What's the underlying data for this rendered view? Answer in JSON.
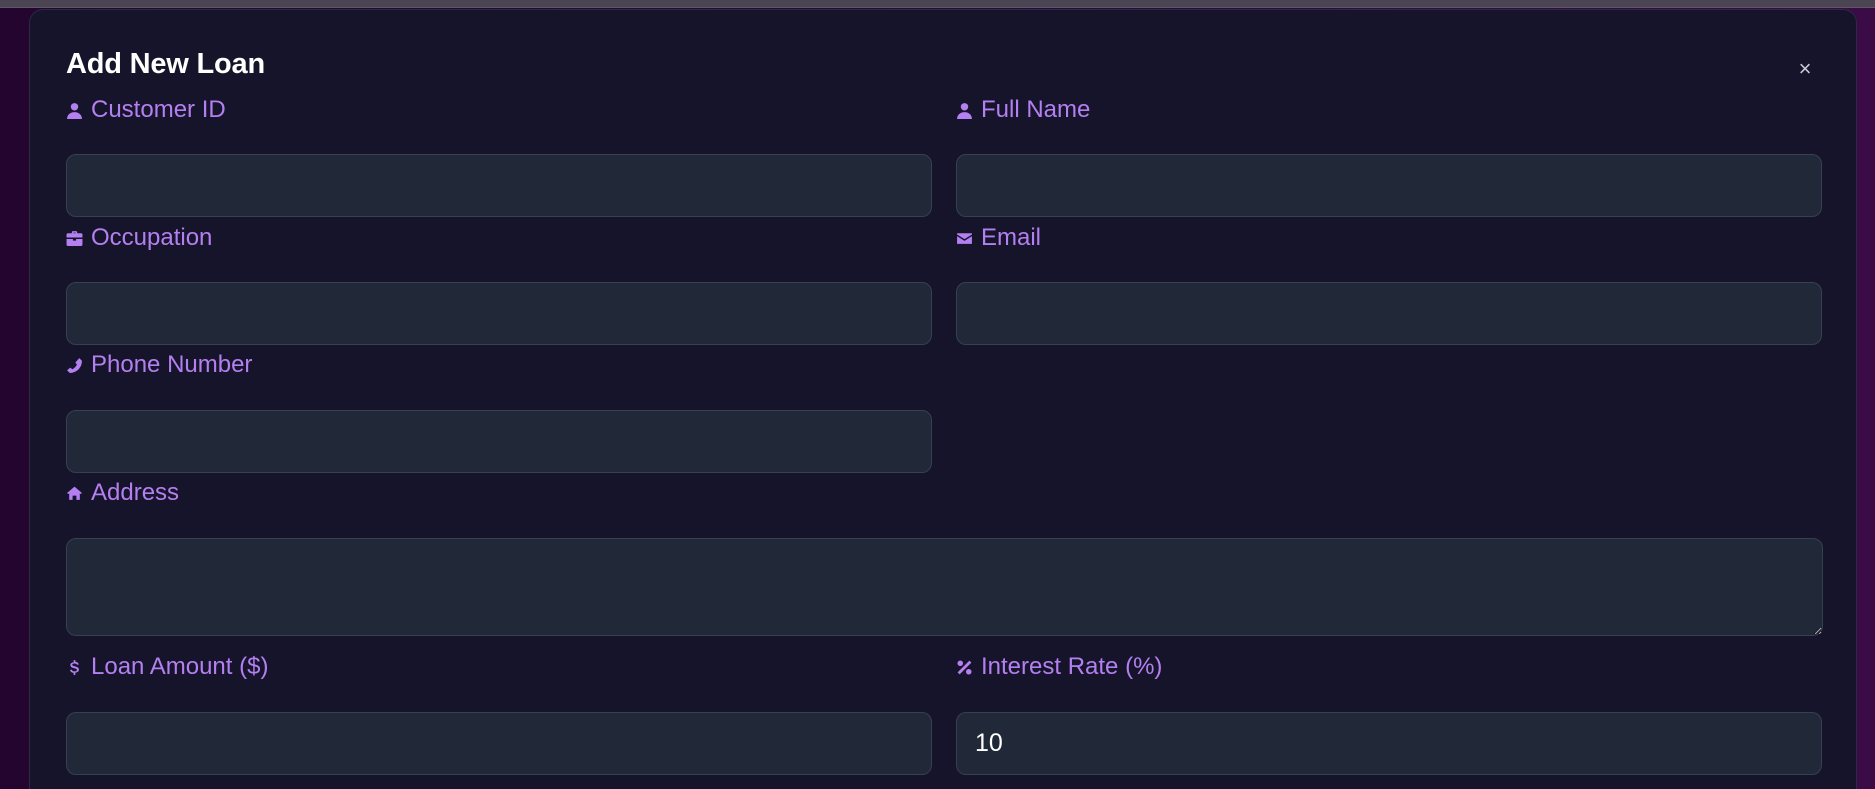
{
  "modal": {
    "title": "Add New Loan",
    "close_label": "×"
  },
  "fields": {
    "customer_id": {
      "label": "Customer ID",
      "icon": "user-icon",
      "value": ""
    },
    "full_name": {
      "label": "Full Name",
      "icon": "user-icon",
      "value": ""
    },
    "occupation": {
      "label": "Occupation",
      "icon": "briefcase-icon",
      "value": ""
    },
    "email": {
      "label": "Email",
      "icon": "envelope-icon",
      "value": ""
    },
    "phone_number": {
      "label": "Phone Number",
      "icon": "phone-icon",
      "value": ""
    },
    "address": {
      "label": "Address",
      "icon": "home-icon",
      "value": ""
    },
    "loan_amount": {
      "label": "Loan Amount ($)",
      "icon": "dollar-icon",
      "value": ""
    },
    "interest_rate": {
      "label": "Interest Rate (%)",
      "icon": "percent-icon",
      "value": "10"
    }
  },
  "colors": {
    "accent": "#b47ff0",
    "modal_bg": "#15142a",
    "input_bg": "#212938",
    "page_bg": "#2d0838"
  }
}
